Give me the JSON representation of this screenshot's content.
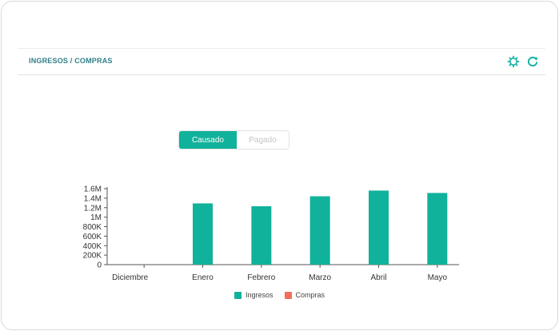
{
  "header": {
    "title": "INGRESOS / COMPRAS"
  },
  "toggle": {
    "active_label": "Causado",
    "inactive_label": "Pagado"
  },
  "colors": {
    "ingresos": "#10b29b",
    "compras": "#f0705a",
    "header_text": "#2f7f87"
  },
  "icons": {
    "settings": "gear-icon",
    "refresh": "refresh-icon"
  },
  "chart_data": {
    "type": "bar",
    "categories": [
      "Diciembre",
      "Enero",
      "Febrero",
      "Marzo",
      "Abril",
      "Mayo"
    ],
    "series": [
      {
        "name": "Ingresos",
        "values": [
          0,
          1290000,
          1230000,
          1440000,
          1560000,
          1510000
        ]
      },
      {
        "name": "Compras",
        "values": [
          0,
          0,
          0,
          0,
          0,
          0
        ]
      }
    ],
    "yticks": [
      "0",
      "200K",
      "400K",
      "600K",
      "800K",
      "1M",
      "1.2M",
      "1.4M",
      "1.6M"
    ],
    "ylim": [
      0,
      1600000
    ],
    "title": "",
    "xlabel": "",
    "ylabel": "",
    "legend": "bottom"
  }
}
